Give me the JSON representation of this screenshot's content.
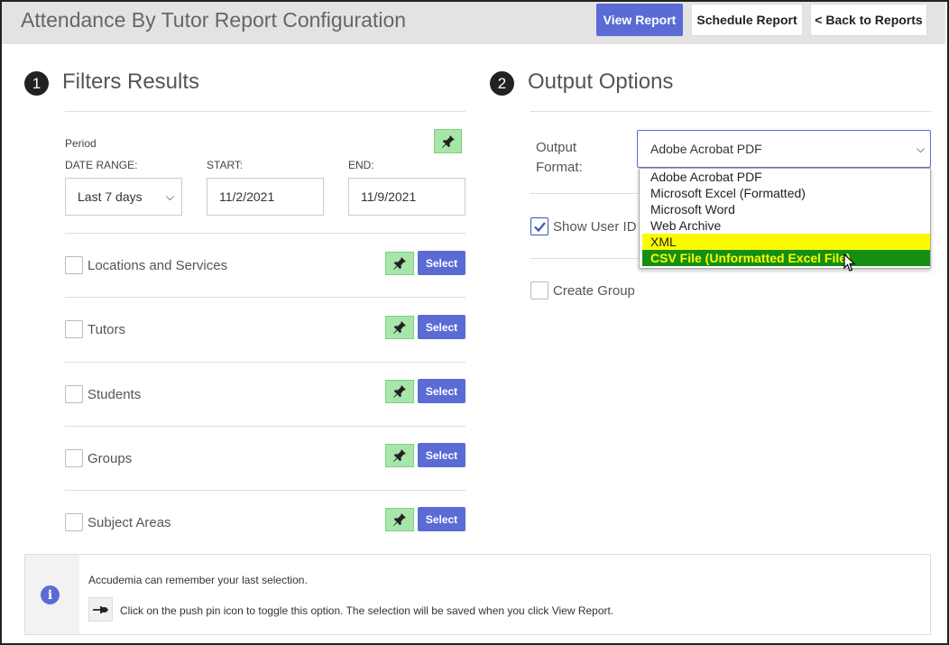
{
  "header": {
    "title": "Attendance By Tutor Report Configuration",
    "view_report": "View Report",
    "schedule_report": "Schedule Report",
    "back_to_reports": "< Back to Reports"
  },
  "filters": {
    "step": "1",
    "title": "Filters Results",
    "period_label": "Period",
    "date_range_label": "DATE RANGE:",
    "date_range_value": "Last 7 days",
    "start_label": "START:",
    "start_value": "11/2/2021",
    "end_label": "END:",
    "end_value": "11/9/2021",
    "select_label": "Select",
    "items": [
      {
        "label": "Locations and Services",
        "checked": false
      },
      {
        "label": "Tutors",
        "checked": false
      },
      {
        "label": "Students",
        "checked": false
      },
      {
        "label": "Groups",
        "checked": false
      },
      {
        "label": "Subject Areas",
        "checked": false
      }
    ]
  },
  "output": {
    "step": "2",
    "title": "Output Options",
    "format_label_line1": "Output",
    "format_label_line2": "Format:",
    "format_value": "Adobe Acrobat PDF",
    "format_options": [
      "Adobe Acrobat PDF",
      "Microsoft Excel (Formatted)",
      "Microsoft Word",
      "Web Archive",
      "XML",
      "CSV File (Unformatted Excel File)"
    ],
    "show_user_id_label": "Show User ID",
    "show_user_id_checked": true,
    "create_group_label": "Create Group",
    "create_group_checked": false
  },
  "info": {
    "line1": "Accudemia can remember your last selection.",
    "line2": "Click on the push pin icon to toggle this option. The selection will be saved when you click View Report."
  },
  "colors": {
    "primary": "#5b6bd6",
    "pin_green": "#a7e6a9",
    "highlight_yellow": "#fbfb00",
    "highlight_green": "#148f14"
  }
}
